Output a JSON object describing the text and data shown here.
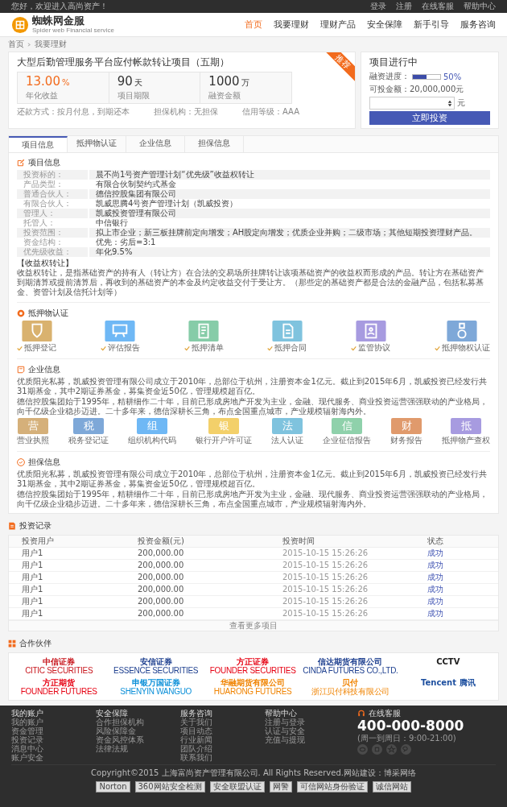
{
  "topbar": {
    "greeting": "您好，欢迎进入高尚资产！",
    "links": [
      "登录",
      "注册",
      "在线客服",
      "帮助中心"
    ]
  },
  "logo": {
    "name": "蜘蛛网金服",
    "tagline": "Spider web Financial service"
  },
  "nav": [
    {
      "label": "首页",
      "selected": true
    },
    {
      "label": "我要理财",
      "selected": false
    },
    {
      "label": "理财产品",
      "selected": false
    },
    {
      "label": "安全保障",
      "selected": false
    },
    {
      "label": "新手引导",
      "selected": false
    },
    {
      "label": "服务咨询",
      "selected": false
    }
  ],
  "breadcrumb": [
    "首页",
    "我要理财"
  ],
  "project": {
    "badge": "推荐",
    "title": "大型后勤管理服务平台应付帐款转让项目（五期）",
    "stats": [
      {
        "value": "13.00",
        "unit": "%",
        "label": "年化收益",
        "kind": "accent"
      },
      {
        "value": "90",
        "unit": "天",
        "label": "项目期限",
        "kind": "plain"
      },
      {
        "value": "1000",
        "unit": "万",
        "label": "融资金额",
        "kind": "plain"
      }
    ],
    "meta": [
      "还款方式：按月付息，到期还本",
      "担保机构：无担保",
      "信用等级：AAA"
    ]
  },
  "status": {
    "title": "项目进行中",
    "progress_label": "融资进度：",
    "level": 0.5,
    "reading": "50%",
    "available": "可投金额：20,000,000元",
    "unit": "元",
    "button": "立即投资"
  },
  "tabs": [
    {
      "label": "项目信息",
      "selected": true
    },
    {
      "label": "抵押物认证",
      "selected": false
    },
    {
      "label": "企业信息",
      "selected": false
    },
    {
      "label": "担保信息",
      "selected": false
    }
  ],
  "info": {
    "title": "项目信息",
    "rows": [
      {
        "label": "投资标的：",
        "value": "晨不尚1号资产管理计划“优先级”收益权转让"
      },
      {
        "label": "产品类型：",
        "value": "有限合伙制契约式基金"
      },
      {
        "label": "普通合伙人：",
        "value": "德信控股集团有限公司"
      },
      {
        "label": "有限合伙人：",
        "value": "凯威思腾4号资产管理计划（凯威投资）"
      },
      {
        "label": "管理人：",
        "value": "凯威投资管理有限公司"
      },
      {
        "label": "托管人：",
        "value": "中信银行"
      },
      {
        "label": "投资范围：",
        "value": "拟上市企业；新三板挂牌前定向增发；AH股定向增发；优质企业并购；二级市场；其他短期投资理财产品。"
      },
      {
        "label": "资金结构：",
        "value": "优先：劣后=3:1"
      },
      {
        "label": "优先级收益：",
        "value": "年化9.5%"
      }
    ],
    "note_title": "【收益权转让】",
    "note": "收益权转让，是指基础资产的持有人（转让方）在合法的交易场所挂牌转让该项基础资产的收益权而形成的产品。转让方在基础资产到期清算或提前清算后，再收到的基础资产的本金及约定收益交付于受让方。（那些定的基础资产都是合法的金融产品，包括私募基金、资管计划及信托计划等）"
  },
  "pledge": {
    "title": "抵押物认证",
    "items": [
      {
        "label": "抵押登记",
        "color": "#d9b26f"
      },
      {
        "label": "评估报告",
        "color": "#6fb8f5"
      },
      {
        "label": "抵押清单",
        "color": "#86cca8"
      },
      {
        "label": "抵押合同",
        "color": "#7fc3de"
      },
      {
        "label": "监管协议",
        "color": "#a79be0"
      },
      {
        "label": "抵押物权认证",
        "color": "#7ea8d8"
      }
    ]
  },
  "enterprise": {
    "title": "企业信息",
    "paragraphs": [
      "优质阳光私募，凯威投资管理有限公司成立于2010年，总部位于杭州，注册资本金1亿元。截止到2015年6月，凯威投资已经发行共31期基金，其中2期证券基金，募集资金近50亿，管理规模超百亿。",
      "德信控股集团始于1995年，精耕细作二十年，目前已形成房地产开发为主业，金融、现代服务、商业投资运营强强联动的产业格局，向千亿级企业稳步迈进。二十多年来，德信深耕长三角，布点全国重点城市，产业规模辐射海内外。"
    ],
    "licenses": [
      {
        "char": "营",
        "label": "营业执照",
        "color": "#d5b07a"
      },
      {
        "char": "税",
        "label": "税务登记证",
        "color": "#7ea8d8"
      },
      {
        "char": "组",
        "label": "组织机构代码",
        "color": "#6fb8f5"
      },
      {
        "char": "银",
        "label": "银行开户许可证",
        "color": "#f3d06a"
      },
      {
        "char": "法",
        "label": "法人认证",
        "color": "#7fc3de"
      },
      {
        "char": "信",
        "label": "企业征信报告",
        "color": "#8fd1ab"
      },
      {
        "char": "财",
        "label": "财务报告",
        "color": "#e09a6c"
      },
      {
        "char": "抵",
        "label": "抵押物产查权",
        "color": "#a79be0"
      }
    ]
  },
  "guarantee": {
    "title": "担保信息",
    "paragraphs": [
      "优质阳光私募，凯威投资管理有限公司成立于2010年，总部位于杭州，注册资本金1亿元。截止到2015年6月，凯威投资已经发行共31期基金，其中2期证券基金，募集资金近50亿，管理规模超百亿。",
      "德信控股集团始于1995年，精耕细作二十年，目前已形成房地产开发为主业，金融、现代服务、商业投资运营强强联动的产业格局，向千亿级企业稳步迈进。二十多年来，德信深耕长三角，布点全国重点城市，产业规模辐射海内外。"
    ]
  },
  "records": {
    "title": "投资记录",
    "columns": [
      "投资用户",
      "投资金额(元)",
      "投资时间",
      "状态"
    ],
    "rows": [
      [
        "用户1",
        "200,000.00",
        "2015-10-15  15:26:26",
        "成功"
      ],
      [
        "用户1",
        "200,000.00",
        "2015-10-15  15:26:26",
        "成功"
      ],
      [
        "用户1",
        "200,000.00",
        "2015-10-15  15:26:26",
        "成功"
      ],
      [
        "用户1",
        "200,000.00",
        "2015-10-15  15:26:26",
        "成功"
      ],
      [
        "用户1",
        "200,000.00",
        "2015-10-15  15:26:26",
        "成功"
      ],
      [
        "用户1",
        "200,000.00",
        "2015-10-15  15:26:26",
        "成功"
      ]
    ],
    "more": "查看更多项目"
  },
  "partners": {
    "title": "合作伙伴",
    "items": [
      {
        "name": "中信证券",
        "sub": "CITIC SECURITIES",
        "color": "#c8161d"
      },
      {
        "name": "安信证券",
        "sub": "ESSENCE SECURITIES",
        "color": "#1d3f8f"
      },
      {
        "name": "方正证券",
        "sub": "FOUNDER SECURITIES",
        "color": "#e60012"
      },
      {
        "name": "信达期货有限公司",
        "sub": "CINDA FUTURES CO.,LTD.",
        "color": "#1d3f8f"
      },
      {
        "name": "CCTV",
        "color": "#222222"
      },
      {
        "name": "方正期货",
        "sub": "FOUNDER FUTURES",
        "color": "#e60012"
      },
      {
        "name": "申银万国证券",
        "sub": "SHENYIN WANGUO",
        "color": "#0a8fd8"
      },
      {
        "name": "华融期货有限公司",
        "sub": "HUARONG FUTURES",
        "color": "#f08300"
      },
      {
        "name": "贝付",
        "sub": "浙江贝付科技有限公司",
        "color": "#f08300"
      },
      {
        "name": "Tencent 腾讯",
        "color": "#1d4f9f"
      }
    ]
  },
  "footer": {
    "columns": [
      {
        "title": "我的账户",
        "links": [
          "我的账户",
          "资金管理",
          "投资记录",
          "消息中心",
          "账户安全"
        ]
      },
      {
        "title": "安全保障",
        "links": [
          "合作担保机构",
          "风险保障金",
          "资金风控体系",
          "法律法规"
        ]
      },
      {
        "title": "服务咨询",
        "links": [
          "关于我们",
          "项目动态",
          "行业新闻",
          "团队介绍",
          "联系我们"
        ]
      },
      {
        "title": "帮助中心",
        "links": [
          "注册与登录",
          "认证与安全",
          "充值与提现"
        ]
      }
    ],
    "service": {
      "title": "在线客服",
      "phone": "400-000-8000",
      "hours": "(周一到周日：9:00-21:00)"
    },
    "copyright": "Copyright©2015 上海富尚资产管理有限公司. All Rights Reserved.网站建设：博采网络",
    "badges": [
      "Norton",
      "360网站安全检测",
      "安全联盟认证",
      "网警",
      "可信网站身份验证",
      "诚信网站"
    ]
  }
}
